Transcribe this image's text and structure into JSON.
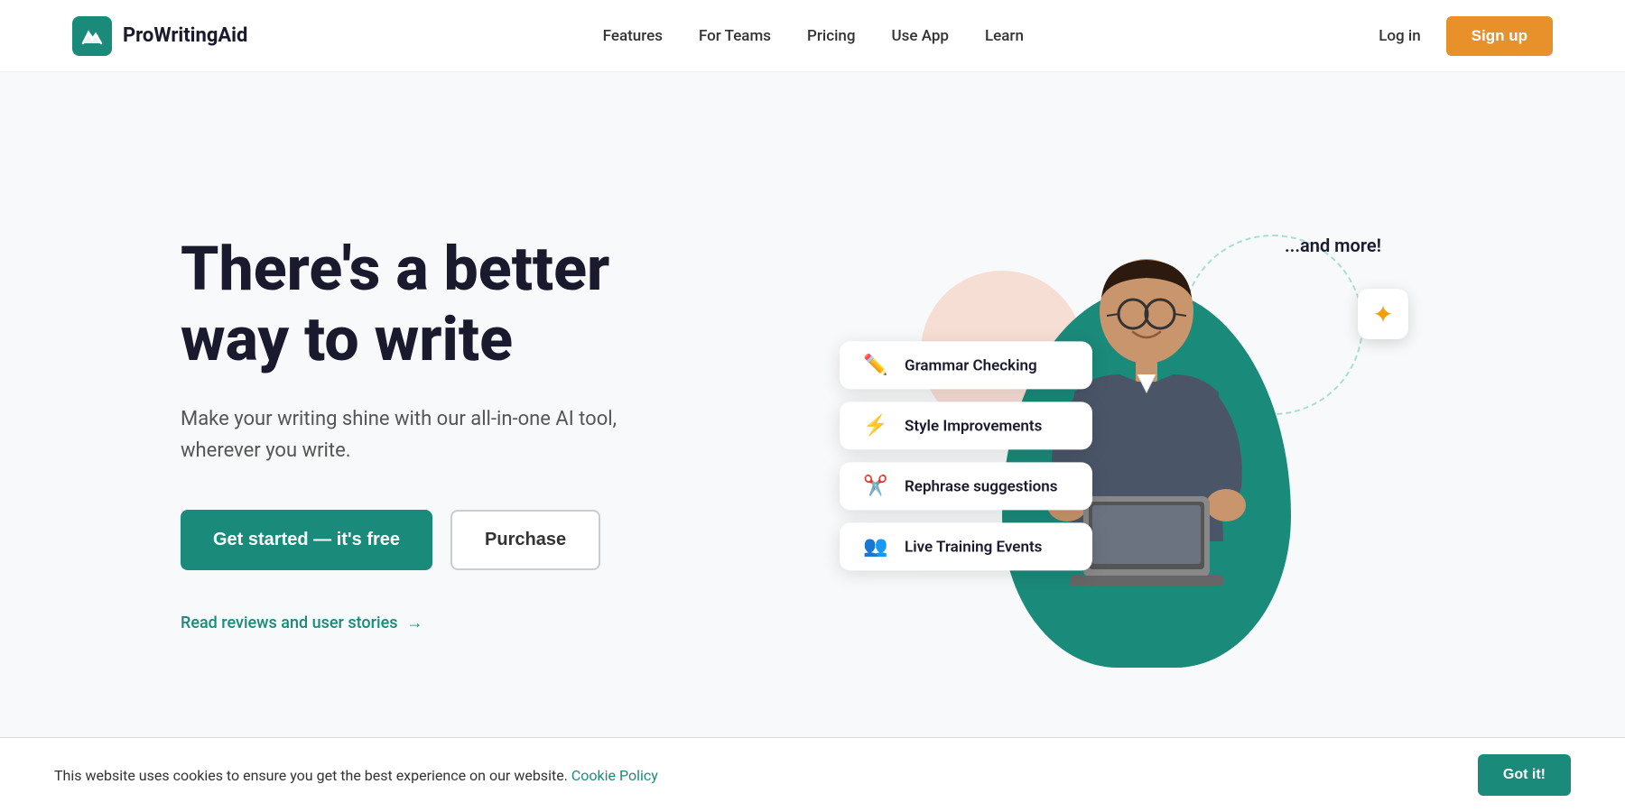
{
  "brand": {
    "name": "ProWritingAid",
    "logo_alt": "ProWritingAid logo"
  },
  "nav": {
    "links": [
      {
        "id": "features",
        "label": "Features"
      },
      {
        "id": "for-teams",
        "label": "For Teams"
      },
      {
        "id": "pricing",
        "label": "Pricing"
      },
      {
        "id": "use-app",
        "label": "Use App"
      },
      {
        "id": "learn",
        "label": "Learn"
      }
    ],
    "login_label": "Log in",
    "signup_label": "Sign up"
  },
  "hero": {
    "title_line1": "There's a better",
    "title_line2": "way to write",
    "subtitle": "Make your writing shine with our all-in-one AI tool, wherever you write.",
    "cta_primary": "Get started  —  it's free",
    "cta_secondary": "Purchase",
    "reviews_link": "Read reviews and user stories"
  },
  "features": [
    {
      "id": "grammar",
      "icon": "✏️",
      "label": "Grammar Checking"
    },
    {
      "id": "style",
      "icon": "⚡",
      "label": "Style Improvements"
    },
    {
      "id": "rephrase",
      "icon": "✂️",
      "label": "Rephrase suggestions"
    },
    {
      "id": "training",
      "icon": "👥",
      "label": "Live Training Events"
    }
  ],
  "and_more_label": "...and more!",
  "cookie": {
    "text": "This website uses cookies to ensure you get the best experience on our website.",
    "link_label": "Cookie Policy",
    "button_label": "Got it!"
  }
}
